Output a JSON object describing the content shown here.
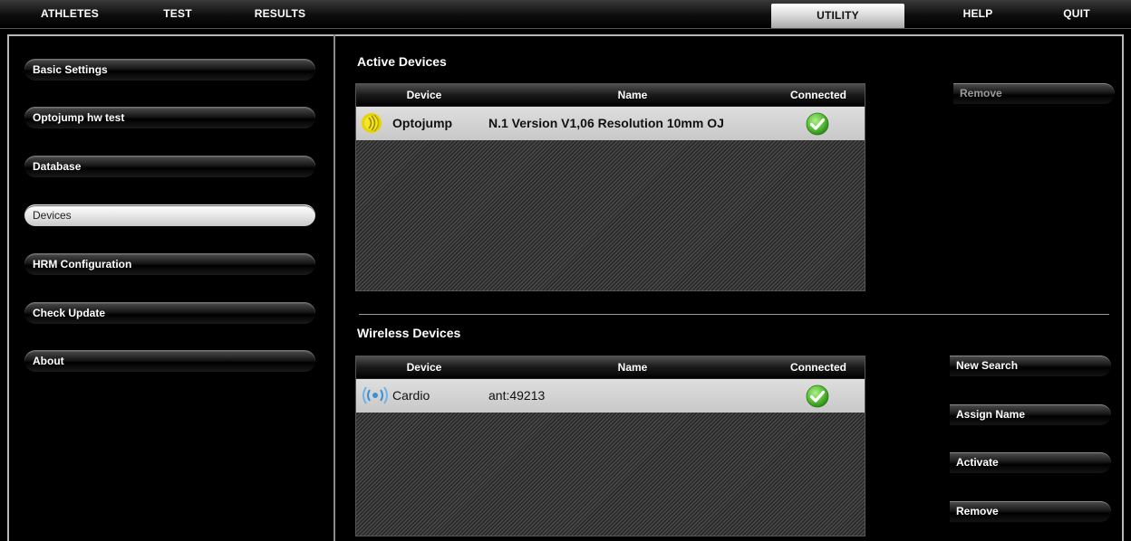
{
  "menu": {
    "athletes": "ATHLETES",
    "test": "TEST",
    "results": "RESULTS",
    "utility": "UTILITY",
    "help": "HELP",
    "quit": "QUIT"
  },
  "sidebar": {
    "items": [
      {
        "label": "Basic Settings"
      },
      {
        "label": "Optojump hw test"
      },
      {
        "label": "Database"
      },
      {
        "label": "Devices"
      },
      {
        "label": "HRM Configuration"
      },
      {
        "label": "Check Update"
      },
      {
        "label": "About"
      }
    ],
    "selected": "Devices"
  },
  "active_devices": {
    "title": "Active Devices",
    "columns": [
      "Device",
      "Name",
      "Connected"
    ],
    "rows": [
      {
        "device": "Optojump",
        "name": "N.1 Version V1,06 Resolution 10mm OJ",
        "connected": true,
        "icon": "optojump-device-icon"
      }
    ],
    "remove_label": "Remove"
  },
  "wireless_devices": {
    "title": "Wireless Devices",
    "columns": [
      "Device",
      "Name",
      "Connected"
    ],
    "rows": [
      {
        "device": "Cardio",
        "name": "ant:49213",
        "connected": true,
        "icon": "wireless-signal-icon"
      }
    ],
    "new_search_label": "New Search",
    "assign_name_label": "Assign Name",
    "activate_label": "Activate",
    "remove_label": "Remove"
  },
  "colors": {
    "accent_active": "#e6e6e6",
    "check_green": "#5bbf3a",
    "wireless_icon": "#3b8fd6",
    "optojump_icon": "#e8d400"
  }
}
